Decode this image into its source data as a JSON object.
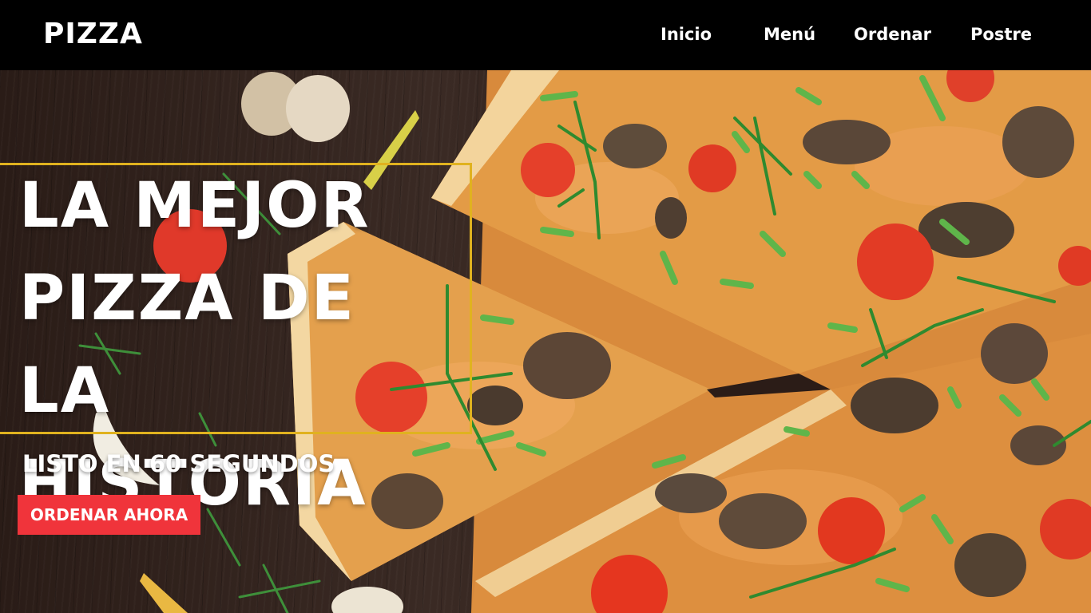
{
  "header": {
    "logo": "PIZZA",
    "nav": [
      {
        "label": "Inicio"
      },
      {
        "label": "Menú"
      },
      {
        "label": "Ordenar"
      },
      {
        "label": "Postre"
      }
    ]
  },
  "hero": {
    "headline_lines": [
      "LA MEJOR",
      "PIZZA DE LA",
      "HISTORIA"
    ],
    "subline": "LISTO EN 60 SEGUNDOS",
    "cta_label": "ORDENAR AHORA",
    "background_image": "pizza-on-wooden-table-photo"
  },
  "colors": {
    "header_bg": "#000000",
    "frame_accent": "#e0b21f",
    "cta_bg": "#f0343b",
    "text": "#ffffff"
  }
}
